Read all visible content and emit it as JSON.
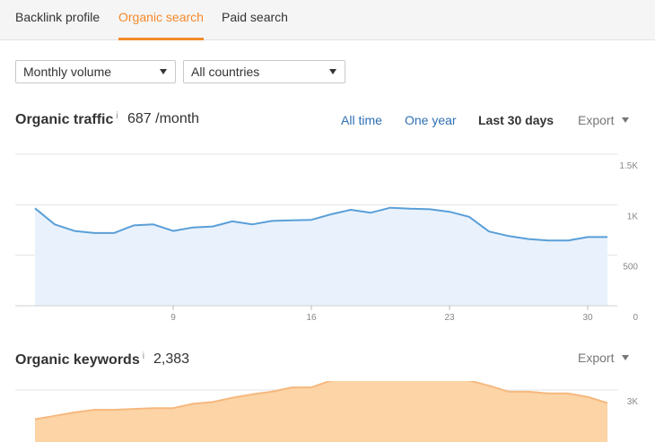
{
  "tabs": [
    {
      "label": "Backlink profile",
      "active": false
    },
    {
      "label": "Organic search",
      "active": true
    },
    {
      "label": "Paid search",
      "active": false
    }
  ],
  "filters": {
    "volume": "Monthly volume",
    "country": "All countries"
  },
  "organic_traffic": {
    "title": "Organic traffic",
    "info": "i",
    "value": "687 /month",
    "ranges": [
      {
        "label": "All time",
        "active": false
      },
      {
        "label": "One year",
        "active": false
      },
      {
        "label": "Last 30 days",
        "active": true
      }
    ],
    "export_label": "Export"
  },
  "organic_keywords": {
    "title": "Organic keywords",
    "info": "i",
    "value": "2,383",
    "export_label": "Export"
  },
  "colors": {
    "accent": "#f4892a",
    "traffic_line": "#5a9fd8",
    "traffic_fill": "#e9f2fc",
    "keywords_line": "#f6b87e",
    "keywords_fill": "#fcd4a6",
    "link": "#2f6fb5"
  },
  "chart_data": [
    {
      "type": "area",
      "series": [
        {
          "values": [
            965,
            805,
            740,
            720,
            720,
            795,
            805,
            740,
            775,
            785,
            835,
            805,
            840,
            845,
            850,
            905,
            950,
            920,
            970,
            960,
            955,
            930,
            880,
            735,
            690,
            660,
            645,
            645,
            680,
            680
          ]
        }
      ],
      "x": [
        2,
        3,
        4,
        5,
        6,
        7,
        8,
        9,
        10,
        11,
        12,
        13,
        14,
        15,
        16,
        17,
        18,
        19,
        20,
        21,
        22,
        23,
        24,
        25,
        26,
        27,
        28,
        29,
        30,
        31
      ],
      "x_ticks": [
        9,
        16,
        23,
        30
      ],
      "y_ticks": [
        "0",
        "500",
        "1K",
        "1.5K"
      ],
      "y_tick_values": [
        0,
        500,
        1000,
        1500
      ],
      "ylim": [
        0,
        1500
      ],
      "grid": true
    },
    {
      "type": "area",
      "series": [
        {
          "values": [
            2660,
            2700,
            2740,
            2770,
            2770,
            2780,
            2790,
            2790,
            2840,
            2860,
            2910,
            2950,
            2980,
            3030,
            3030,
            3110,
            3130,
            3150,
            3170,
            3170,
            3160,
            3150,
            3110,
            3050,
            2980,
            2980,
            2960,
            2960,
            2920,
            2850
          ]
        }
      ],
      "x": [
        2,
        3,
        4,
        5,
        6,
        7,
        8,
        9,
        10,
        11,
        12,
        13,
        14,
        15,
        16,
        17,
        18,
        19,
        20,
        21,
        22,
        23,
        24,
        25,
        26,
        27,
        28,
        29,
        30,
        31
      ],
      "y_ticks": [
        "3K"
      ],
      "y_tick_values": [
        3000
      ],
      "ylim": [
        2000,
        3500
      ],
      "grid": true
    }
  ]
}
